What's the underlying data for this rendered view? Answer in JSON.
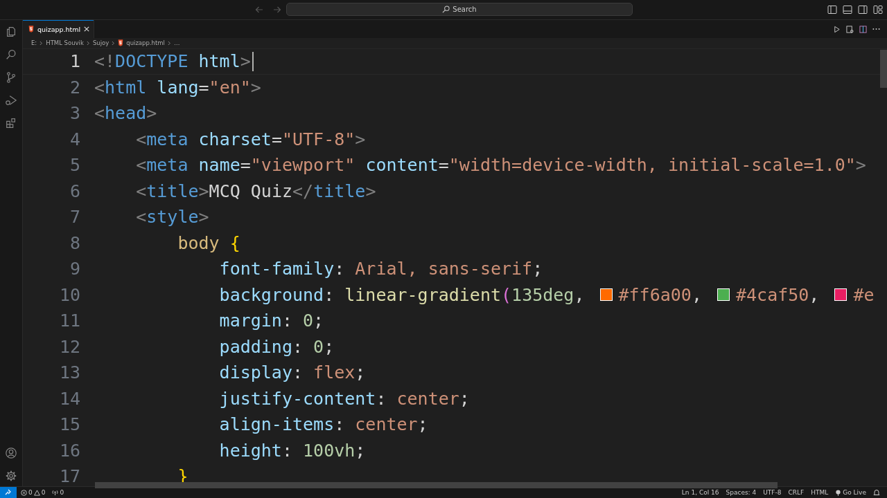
{
  "title_bar": {
    "search_placeholder": "Search"
  },
  "tabs": [
    {
      "label": "quizapp.html",
      "selected": true,
      "kind": "html"
    }
  ],
  "breadcrumbs": [
    {
      "label": "E:",
      "kind": "folder"
    },
    {
      "label": "HTML Souvik",
      "kind": "folder"
    },
    {
      "label": "Sujoy",
      "kind": "folder"
    },
    {
      "label": "quizapp.html",
      "kind": "html"
    },
    {
      "label": "…",
      "kind": "symbol"
    }
  ],
  "editor": {
    "lines": [
      {
        "number": "1",
        "current": true,
        "segments": [
          {
            "kind": "code",
            "tokens": [
              {
                "kind": "punct",
                "text": "<!"
              },
              {
                "kind": "tag",
                "text": "DOCTYPE"
              },
              {
                "kind": "attr",
                "text": " html"
              },
              {
                "kind": "punct",
                "text": ">"
              }
            ]
          }
        ]
      },
      {
        "number": "2",
        "current": false,
        "segments": [
          {
            "kind": "code",
            "tokens": [
              {
                "kind": "punct",
                "text": "<"
              },
              {
                "kind": "tag",
                "text": "html"
              },
              {
                "kind": "attr",
                "text": " lang"
              },
              {
                "kind": "text",
                "text": "="
              },
              {
                "kind": "str",
                "text": "\"en\""
              },
              {
                "kind": "punct",
                "text": ">"
              }
            ]
          }
        ]
      },
      {
        "number": "3",
        "current": false,
        "segments": [
          {
            "kind": "code",
            "tokens": [
              {
                "kind": "punct",
                "text": "<"
              },
              {
                "kind": "tag",
                "text": "head"
              },
              {
                "kind": "punct",
                "text": ">"
              }
            ]
          }
        ]
      },
      {
        "number": "4",
        "current": false,
        "segments": [
          {
            "kind": "code",
            "tokens": [
              {
                "kind": "punct",
                "text": "    <"
              },
              {
                "kind": "tag",
                "text": "meta"
              },
              {
                "kind": "attr",
                "text": " charset"
              },
              {
                "kind": "text",
                "text": "="
              },
              {
                "kind": "str",
                "text": "\"UTF-8\""
              },
              {
                "kind": "punct",
                "text": ">"
              }
            ]
          }
        ]
      },
      {
        "number": "5",
        "current": false,
        "segments": [
          {
            "kind": "code",
            "tokens": [
              {
                "kind": "punct",
                "text": "    <"
              },
              {
                "kind": "tag",
                "text": "meta"
              },
              {
                "kind": "attr",
                "text": " name"
              },
              {
                "kind": "text",
                "text": "="
              },
              {
                "kind": "str",
                "text": "\"viewport\""
              },
              {
                "kind": "attr",
                "text": " content"
              },
              {
                "kind": "text",
                "text": "="
              },
              {
                "kind": "str",
                "text": "\"width=device-width, initial-scale=1.0\""
              },
              {
                "kind": "punct",
                "text": ">"
              }
            ]
          }
        ]
      },
      {
        "number": "6",
        "current": false,
        "segments": [
          {
            "kind": "code",
            "tokens": [
              {
                "kind": "punct",
                "text": "    <"
              },
              {
                "kind": "tag",
                "text": "title"
              },
              {
                "kind": "punct",
                "text": ">"
              },
              {
                "kind": "text",
                "text": "MCQ Quiz"
              },
              {
                "kind": "punct",
                "text": "</"
              },
              {
                "kind": "tag",
                "text": "title"
              },
              {
                "kind": "punct",
                "text": ">"
              }
            ]
          }
        ]
      },
      {
        "number": "7",
        "current": false,
        "segments": [
          {
            "kind": "code",
            "tokens": [
              {
                "kind": "punct",
                "text": "    <"
              },
              {
                "kind": "tag",
                "text": "style"
              },
              {
                "kind": "punct",
                "text": ">"
              }
            ]
          }
        ]
      },
      {
        "number": "8",
        "current": false,
        "segments": [
          {
            "kind": "code",
            "tokens": [
              {
                "kind": "sel",
                "text": "        body "
              },
              {
                "kind": "brace",
                "text": "{"
              }
            ]
          }
        ]
      },
      {
        "number": "9",
        "current": false,
        "segments": [
          {
            "kind": "code",
            "tokens": [
              {
                "kind": "prop",
                "text": "            font-family"
              },
              {
                "kind": "text",
                "text": ": "
              },
              {
                "kind": "val",
                "text": "Arial, sans-serif"
              },
              {
                "kind": "text",
                "text": ";"
              }
            ]
          }
        ]
      },
      {
        "number": "10",
        "current": false,
        "segments": [
          {
            "kind": "code",
            "tokens": [
              {
                "kind": "prop",
                "text": "            background"
              },
              {
                "kind": "text",
                "text": ": "
              },
              {
                "kind": "fn",
                "text": "linear-gradient"
              },
              {
                "kind": "paren",
                "text": "("
              },
              {
                "kind": "num",
                "text": "135deg"
              },
              {
                "kind": "text",
                "text": ", "
              }
            ]
          },
          {
            "kind": "swatch",
            "color": "#ff6a00"
          },
          {
            "kind": "code",
            "tokens": [
              {
                "kind": "val",
                "text": "#ff6a00"
              },
              {
                "kind": "text",
                "text": ", "
              }
            ]
          },
          {
            "kind": "swatch",
            "color": "#4caf50"
          },
          {
            "kind": "code",
            "tokens": [
              {
                "kind": "val",
                "text": "#4caf50"
              },
              {
                "kind": "text",
                "text": ", "
              }
            ]
          },
          {
            "kind": "swatch",
            "color": "#e91e63"
          },
          {
            "kind": "code",
            "tokens": [
              {
                "kind": "val",
                "text": "#e"
              }
            ]
          }
        ]
      },
      {
        "number": "11",
        "current": false,
        "segments": [
          {
            "kind": "code",
            "tokens": [
              {
                "kind": "prop",
                "text": "            margin"
              },
              {
                "kind": "text",
                "text": ": "
              },
              {
                "kind": "num",
                "text": "0"
              },
              {
                "kind": "text",
                "text": ";"
              }
            ]
          }
        ]
      },
      {
        "number": "12",
        "current": false,
        "segments": [
          {
            "kind": "code",
            "tokens": [
              {
                "kind": "prop",
                "text": "            padding"
              },
              {
                "kind": "text",
                "text": ": "
              },
              {
                "kind": "num",
                "text": "0"
              },
              {
                "kind": "text",
                "text": ";"
              }
            ]
          }
        ]
      },
      {
        "number": "13",
        "current": false,
        "segments": [
          {
            "kind": "code",
            "tokens": [
              {
                "kind": "prop",
                "text": "            display"
              },
              {
                "kind": "text",
                "text": ": "
              },
              {
                "kind": "val",
                "text": "flex"
              },
              {
                "kind": "text",
                "text": ";"
              }
            ]
          }
        ]
      },
      {
        "number": "14",
        "current": false,
        "segments": [
          {
            "kind": "code",
            "tokens": [
              {
                "kind": "prop",
                "text": "            justify-content"
              },
              {
                "kind": "text",
                "text": ": "
              },
              {
                "kind": "val",
                "text": "center"
              },
              {
                "kind": "text",
                "text": ";"
              }
            ]
          }
        ]
      },
      {
        "number": "15",
        "current": false,
        "segments": [
          {
            "kind": "code",
            "tokens": [
              {
                "kind": "prop",
                "text": "            align-items"
              },
              {
                "kind": "text",
                "text": ": "
              },
              {
                "kind": "val",
                "text": "center"
              },
              {
                "kind": "text",
                "text": ";"
              }
            ]
          }
        ]
      },
      {
        "number": "16",
        "current": false,
        "segments": [
          {
            "kind": "code",
            "tokens": [
              {
                "kind": "prop",
                "text": "            height"
              },
              {
                "kind": "text",
                "text": ": "
              },
              {
                "kind": "num",
                "text": "100vh"
              },
              {
                "kind": "text",
                "text": ";"
              }
            ]
          }
        ]
      },
      {
        "number": "17",
        "current": false,
        "segments": [
          {
            "kind": "code",
            "tokens": [
              {
                "kind": "brace",
                "text": "        }"
              }
            ]
          }
        ]
      }
    ]
  },
  "status_bar": {
    "errors": "0",
    "warnings": "0",
    "ports": "0",
    "right": [
      {
        "label": "Ln 1, Col 16",
        "kind": "text"
      },
      {
        "label": "Spaces: 4",
        "kind": "text"
      },
      {
        "label": "UTF-8",
        "kind": "text"
      },
      {
        "label": "CRLF",
        "kind": "text"
      },
      {
        "label": "HTML",
        "kind": "text"
      },
      {
        "label": "Go Live",
        "kind": "live"
      }
    ]
  }
}
